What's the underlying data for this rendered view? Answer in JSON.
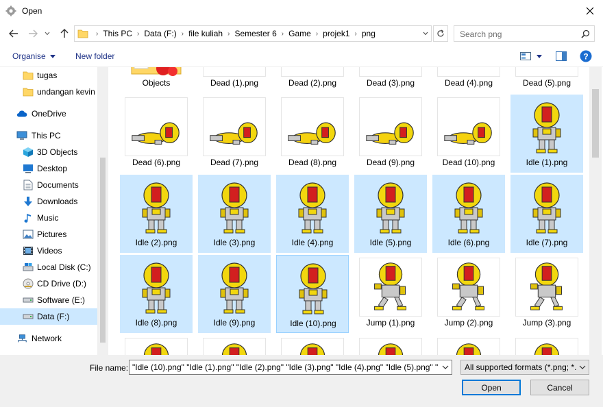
{
  "window": {
    "title": "Open"
  },
  "address": {
    "crumbs": [
      "This PC",
      "Data (F:)",
      "file kuliah",
      "Semester 6",
      "Game",
      "projek1",
      "png"
    ]
  },
  "search": {
    "placeholder": "Search png"
  },
  "toolbar": {
    "organise_label": "Organise",
    "new_folder_label": "New folder",
    "help_label": "?"
  },
  "sidebar": {
    "items": [
      {
        "label": "tugas",
        "icon": "folder-icon",
        "selected": false
      },
      {
        "label": "undangan kevin",
        "icon": "folder-icon",
        "selected": false
      },
      {
        "label": "OneDrive",
        "icon": "cloud-icon",
        "selected": false
      },
      {
        "label": "This PC",
        "icon": "computer-icon",
        "selected": false
      },
      {
        "label": "3D Objects",
        "icon": "cube-icon",
        "selected": false
      },
      {
        "label": "Desktop",
        "icon": "desktop-icon",
        "selected": false
      },
      {
        "label": "Documents",
        "icon": "document-icon",
        "selected": false
      },
      {
        "label": "Downloads",
        "icon": "download-icon",
        "selected": false
      },
      {
        "label": "Music",
        "icon": "music-note-icon",
        "selected": false
      },
      {
        "label": "Pictures",
        "icon": "picture-icon",
        "selected": false
      },
      {
        "label": "Videos",
        "icon": "film-icon",
        "selected": false
      },
      {
        "label": "Local Disk (C:)",
        "icon": "drive-icon",
        "selected": false
      },
      {
        "label": "CD Drive (D:)",
        "icon": "cd-icon",
        "selected": false
      },
      {
        "label": "Software (E:)",
        "icon": "drive-icon",
        "selected": false
      },
      {
        "label": "Data (F:)",
        "icon": "drive-icon",
        "selected": true
      },
      {
        "label": "Network",
        "icon": "network-icon",
        "selected": false
      }
    ]
  },
  "files": [
    {
      "name": "Objects",
      "kind": "folder",
      "selected": false
    },
    {
      "name": "Dead (1).png",
      "kind": "dead",
      "selected": false
    },
    {
      "name": "Dead (2).png",
      "kind": "dead",
      "selected": false
    },
    {
      "name": "Dead (3).png",
      "kind": "dead",
      "selected": false
    },
    {
      "name": "Dead (4).png",
      "kind": "dead",
      "selected": false
    },
    {
      "name": "Dead (5).png",
      "kind": "dead",
      "selected": false
    },
    {
      "name": "Dead (6).png",
      "kind": "dead",
      "selected": false
    },
    {
      "name": "Dead (7).png",
      "kind": "dead",
      "selected": false
    },
    {
      "name": "Dead (8).png",
      "kind": "dead",
      "selected": false
    },
    {
      "name": "Dead (9).png",
      "kind": "dead",
      "selected": false
    },
    {
      "name": "Dead (10).png",
      "kind": "dead",
      "selected": false
    },
    {
      "name": "Idle (1).png",
      "kind": "idle",
      "selected": true
    },
    {
      "name": "Idle (2).png",
      "kind": "idle",
      "selected": true
    },
    {
      "name": "Idle (3).png",
      "kind": "idle",
      "selected": true
    },
    {
      "name": "Idle (4).png",
      "kind": "idle",
      "selected": true
    },
    {
      "name": "Idle (5).png",
      "kind": "idle",
      "selected": true
    },
    {
      "name": "Idle (6).png",
      "kind": "idle",
      "selected": true
    },
    {
      "name": "Idle (7).png",
      "kind": "idle",
      "selected": true
    },
    {
      "name": "Idle (8).png",
      "kind": "idle",
      "selected": true
    },
    {
      "name": "Idle (9).png",
      "kind": "idle",
      "selected": true
    },
    {
      "name": "Idle (10).png",
      "kind": "idle",
      "selected": true,
      "focused": true
    },
    {
      "name": "Jump (1).png",
      "kind": "jump",
      "selected": false
    },
    {
      "name": "Jump (2).png",
      "kind": "jump",
      "selected": false
    },
    {
      "name": "Jump (3).png",
      "kind": "jump",
      "selected": false
    },
    {
      "name": "",
      "kind": "partial",
      "selected": false
    },
    {
      "name": "",
      "kind": "partial",
      "selected": false
    },
    {
      "name": "",
      "kind": "partial",
      "selected": false
    },
    {
      "name": "",
      "kind": "partial",
      "selected": false
    },
    {
      "name": "",
      "kind": "partial",
      "selected": false
    },
    {
      "name": "",
      "kind": "partial",
      "selected": false
    }
  ],
  "footer": {
    "file_name_label": "File name:",
    "file_name_value": "\"Idle (10).png\" \"Idle (1).png\" \"Idle (2).png\" \"Idle (3).png\" \"Idle (4).png\" \"Idle (5).png\" \"",
    "filter_value": "All supported formats (*.png; *.",
    "open_label": "Open",
    "cancel_label": "Cancel"
  },
  "colors": {
    "selection": "#cce8ff",
    "accent": "#0078d7",
    "link": "#1e3287"
  }
}
